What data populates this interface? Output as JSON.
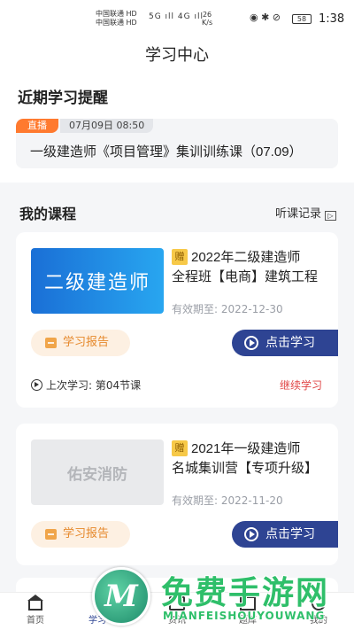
{
  "status_bar": {
    "carrier_1": "中国联通 HD",
    "carrier_2": "中国联通 HD",
    "signal": "5G ıll 4G ıll",
    "speed_value": "26",
    "speed_unit": "K/s",
    "icons": "◉ ✱ ⊘",
    "battery": "58",
    "time": "1:38"
  },
  "header": {
    "title": "学习中心"
  },
  "reminders": {
    "title": "近期学习提醒",
    "items": [
      {
        "badge": "直播",
        "datetime": "07月09日 08:50",
        "course": "一级建造师《项目管理》集训训练课（07.09）"
      }
    ]
  },
  "my_courses": {
    "title": "我的课程",
    "history_label": "听课记录",
    "history_icon": "▷",
    "courses": [
      {
        "thumb_text": "二级建造师",
        "gift": "赠",
        "name_line1": "2022年二级建造师",
        "name_line2": "全程班【电商】建筑工程",
        "expiry": "有效期至: 2022-12-30",
        "report_label": "学习报告",
        "study_label": "点击学习",
        "last_study": "上次学习: 第04节课",
        "continue_label": "继续学习"
      },
      {
        "thumb_text": "佑安消防",
        "gift": "赠",
        "name_line1": "2021年一级建造师",
        "name_line2": "名城集训营【专项升级】",
        "expiry": "有效期至: 2022-11-20",
        "report_label": "学习报告",
        "study_label": "点击学习"
      }
    ]
  },
  "tabbar": {
    "tabs": [
      {
        "label": "首页",
        "icon": "home-icon"
      },
      {
        "label": "学习中心",
        "icon": "study-icon"
      },
      {
        "label": "资讯",
        "icon": "news-icon"
      },
      {
        "label": "题库",
        "icon": "question-bank-icon"
      },
      {
        "label": "我的",
        "icon": "profile-icon"
      }
    ]
  },
  "watermark": {
    "logo_letter": "M",
    "title": "免费手游网",
    "subtitle": "MIANFEISHOUYOUWANG"
  },
  "colors": {
    "accent": "#2e4493",
    "live": "#ff7a2f",
    "continue": "#e04545",
    "report": "#e6892c"
  }
}
